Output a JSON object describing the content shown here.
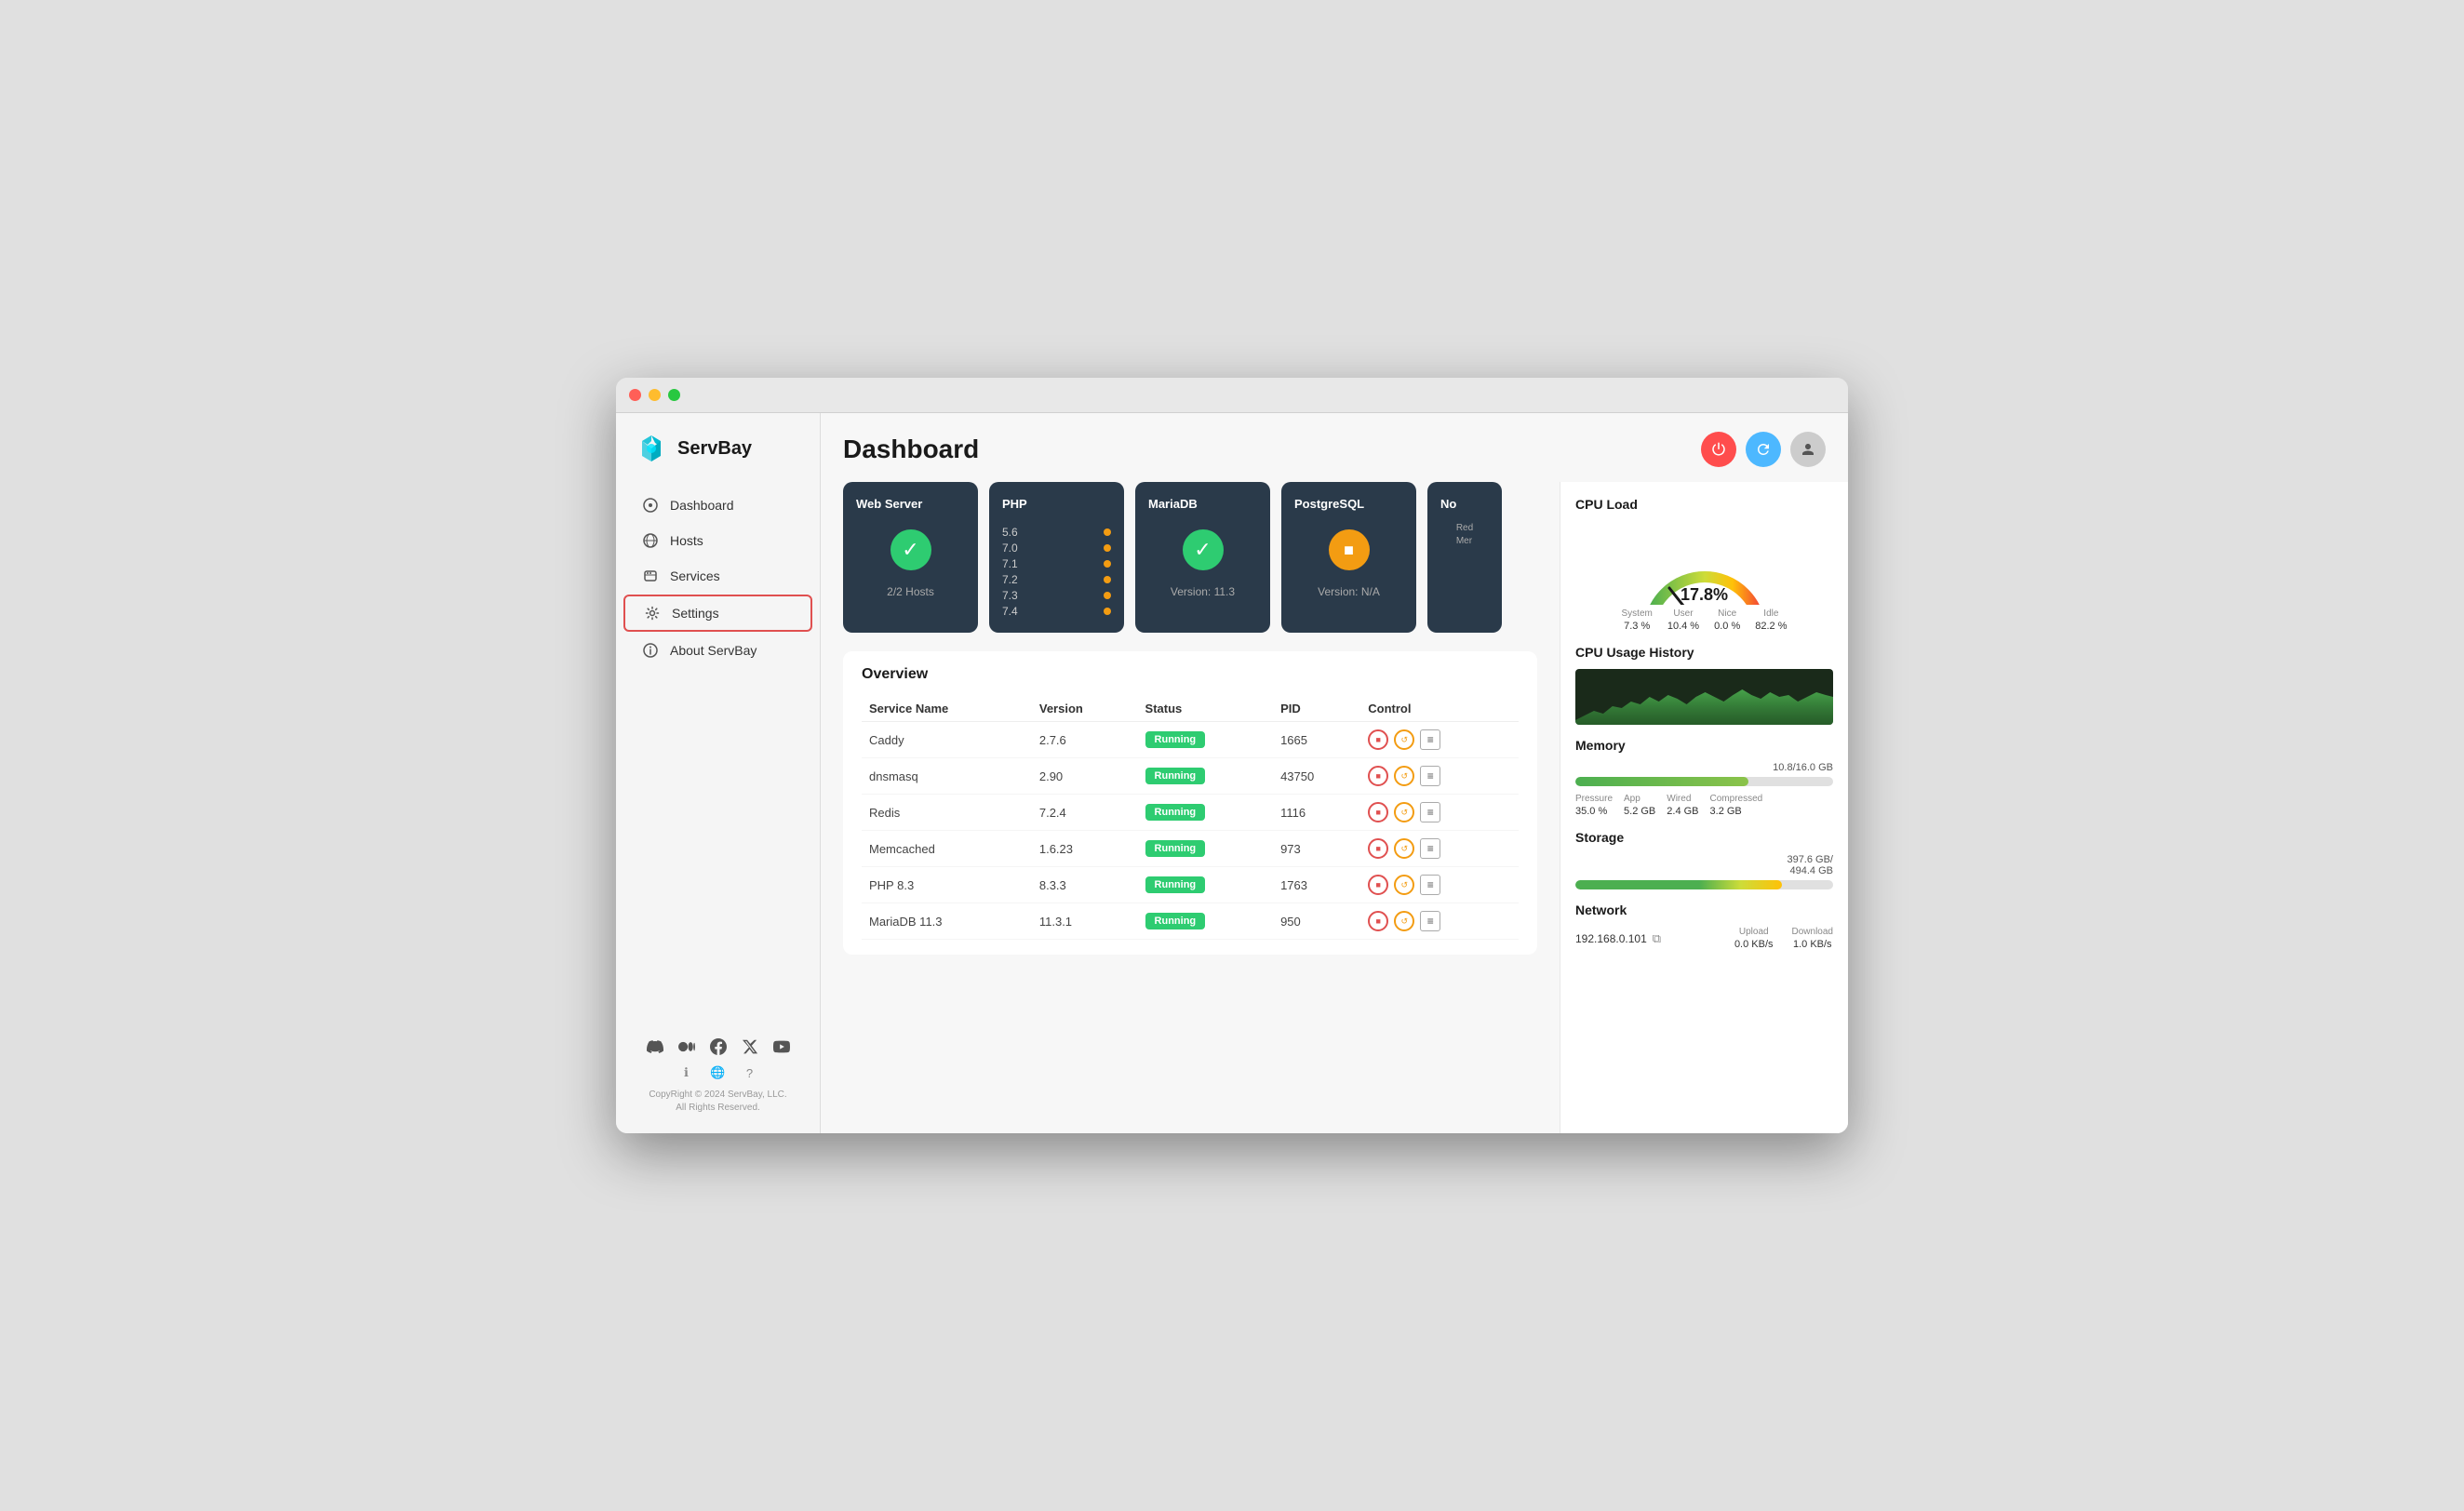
{
  "window": {
    "title": "ServBay"
  },
  "titlebar": {
    "tl_red": "close",
    "tl_yellow": "minimize",
    "tl_green": "maximize"
  },
  "sidebar": {
    "logo_text": "ServBay",
    "nav_items": [
      {
        "id": "dashboard",
        "label": "Dashboard",
        "icon": "⊙"
      },
      {
        "id": "hosts",
        "label": "Hosts",
        "icon": "⊕"
      },
      {
        "id": "services",
        "label": "Services",
        "icon": "⊟"
      },
      {
        "id": "settings",
        "label": "Settings",
        "icon": "⚙",
        "active_settings": true
      },
      {
        "id": "about",
        "label": "About ServBay",
        "icon": "ℹ"
      }
    ],
    "social_icons": [
      "discord",
      "medium",
      "facebook",
      "x",
      "youtube"
    ],
    "footer_icons": [
      "info",
      "globe",
      "help"
    ],
    "copyright": "CopyRight © 2024 ServBay, LLC.\nAll Rights Reserved."
  },
  "header": {
    "title": "Dashboard",
    "btn_power": "⏻",
    "btn_refresh": "↻",
    "btn_user": "👤"
  },
  "service_cards": [
    {
      "id": "webserver",
      "title": "Web Server",
      "status": "check",
      "subtitle": "2/2 Hosts"
    },
    {
      "id": "php",
      "title": "PHP",
      "status": "php",
      "versions": [
        "5.6",
        "7.0",
        "7.1",
        "7.2",
        "7.3",
        "7.4"
      ]
    },
    {
      "id": "mariadb",
      "title": "MariaDB",
      "status": "check",
      "subtitle": "Version: 11.3"
    },
    {
      "id": "postgresql",
      "title": "PostgreSQL",
      "status": "stop",
      "subtitle": "Version: N/A"
    },
    {
      "id": "other",
      "title": "No",
      "subtitle": "Red\nMer"
    }
  ],
  "overview": {
    "title": "Overview",
    "columns": [
      "Service Name",
      "Version",
      "Status",
      "PID",
      "Control"
    ],
    "rows": [
      {
        "name": "Caddy",
        "version": "2.7.6",
        "status": "Running",
        "pid": "1665"
      },
      {
        "name": "dnsmasq",
        "version": "2.90",
        "status": "Running",
        "pid": "43750"
      },
      {
        "name": "Redis",
        "version": "7.2.4",
        "status": "Running",
        "pid": "1116"
      },
      {
        "name": "Memcached",
        "version": "1.6.23",
        "status": "Running",
        "pid": "973"
      },
      {
        "name": "PHP 8.3",
        "version": "8.3.3",
        "status": "Running",
        "pid": "1763"
      },
      {
        "name": "MariaDB 11.3",
        "version": "11.3.1",
        "status": "Running",
        "pid": "950"
      }
    ]
  },
  "right_panel": {
    "cpu_load": {
      "title": "CPU Load",
      "value": "17.8%",
      "stats": [
        {
          "label": "System",
          "value": "7.3 %"
        },
        {
          "label": "User",
          "value": "10.4 %"
        },
        {
          "label": "Nice",
          "value": "0.0 %"
        },
        {
          "label": "Idle",
          "value": "82.2 %"
        }
      ]
    },
    "cpu_history": {
      "title": "CPU Usage History"
    },
    "memory": {
      "title": "Memory",
      "used": "10.8",
      "total": "16.0",
      "unit": "GB",
      "bar_pct": 67,
      "stats": [
        {
          "label": "Pressure",
          "value": "35.0 %"
        },
        {
          "label": "App",
          "value": "5.2 GB"
        },
        {
          "label": "Wired",
          "value": "2.4 GB"
        },
        {
          "label": "Compressed",
          "value": "3.2 GB"
        }
      ]
    },
    "storage": {
      "title": "Storage",
      "used": "397.6 GB",
      "total": "494.4 GB",
      "bar_pct": 80
    },
    "network": {
      "title": "Network",
      "ip": "192.168.0.101",
      "upload_label": "Upload",
      "upload_value": "0.0 KB/s",
      "download_label": "Download",
      "download_value": "1.0 KB/s"
    }
  }
}
